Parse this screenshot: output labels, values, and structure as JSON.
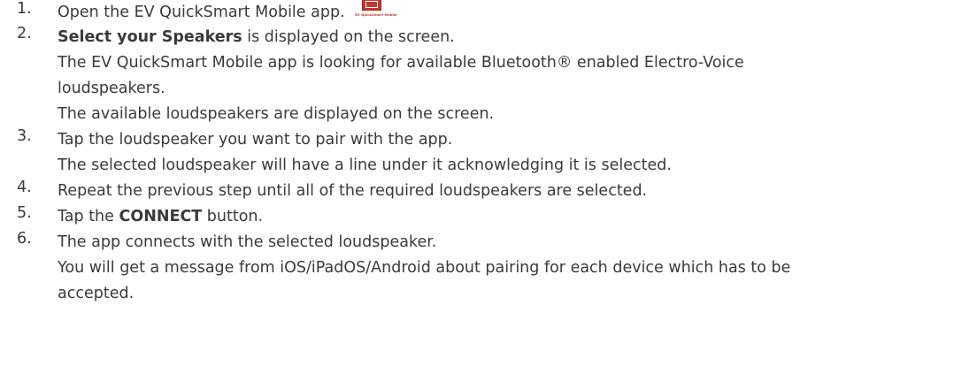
{
  "steps": [
    {
      "number": "1.",
      "lines": [
        {
          "pre": "Open the EV QuickSmart Mobile app."
        }
      ],
      "icon": {
        "name": "ev-quicksmart-mobile-app-icon",
        "caption": "EV QuickSmart Mobile",
        "color": "#c8362f"
      }
    },
    {
      "number": "2.",
      "lines": [
        {
          "bold": "Select your Speakers",
          "post": " is displayed on the screen."
        },
        {
          "text": "The EV QuickSmart Mobile app is looking for available Bluetooth® enabled Electro-Voice"
        },
        {
          "text": "loudspeakers."
        },
        {
          "text": "The available loudspeakers are displayed on the screen."
        }
      ]
    },
    {
      "number": "3.",
      "lines": [
        {
          "text": "Tap the loudspeaker you want to pair with the app."
        },
        {
          "text": "The selected loudspeaker will have a line under it acknowledging it is selected."
        }
      ]
    },
    {
      "number": "4.",
      "lines": [
        {
          "text": "Repeat the previous step until all of the required loudspeakers are selected."
        }
      ]
    },
    {
      "number": "5.",
      "lines": [
        {
          "pre": "Tap the ",
          "bold": "CONNECT",
          "post": " button."
        }
      ]
    },
    {
      "number": "6.",
      "lines": [
        {
          "text": "The app connects with the selected loudspeaker."
        },
        {
          "text": "You will get a message from iOS/iPadOS/Android about pairing for each device which has to be"
        },
        {
          "text": "accepted."
        }
      ]
    }
  ]
}
